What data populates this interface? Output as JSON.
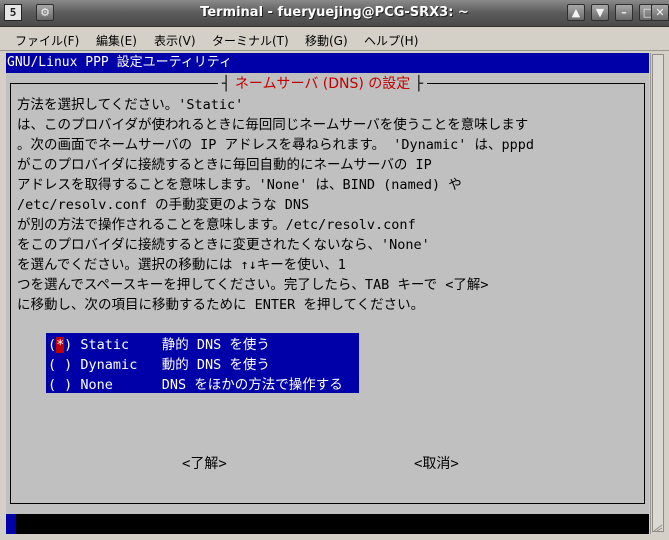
{
  "window": {
    "title": "Terminal - fueryuejing@PCG-SRX3: ~",
    "app_icon": "terminal-icon",
    "controls": {
      "up": "▲",
      "down": "▼",
      "minimize": "–",
      "maximize": "□",
      "close": "✕"
    }
  },
  "menu": [
    {
      "label": "ファイル(F)"
    },
    {
      "label": "編集(E)"
    },
    {
      "label": "表示(V)"
    },
    {
      "label": "ターミナル(T)"
    },
    {
      "label": "移動(G)"
    },
    {
      "label": "ヘルプ(H)"
    }
  ],
  "terminal": {
    "backtitle": "GNU/Linux PPP 設定ユーティリティ",
    "dialog_title": "ネームサーバ (DNS) の設定",
    "dialog_title_left_bar": "┤",
    "dialog_title_right_bar": "├",
    "lines": [
      "方法を選択してください。'Static'",
      "は、このプロバイダが使われるときに毎回同じネームサーバを使うことを意味します",
      "。次の画面でネームサーバの IP アドレスを尋ねられます。 'Dynamic' は、pppd",
      "がこのプロバイダに接続するときに毎回自動的にネームサーバの IP",
      "アドレスを取得することを意味します。'None' は、BIND (named) や",
      "/etc/resolv.conf の手動変更のような DNS",
      "が別の方法で操作されることを意味します。/etc/resolv.conf",
      "をこのプロバイダに接続するときに変更されたくないなら、'None'",
      "を選んでください。選択の移動には ↑↓キーを使い、1",
      "つを選んでスペースキーを押してください。完了したら、TAB キーで <了解>",
      "に移動し、次の項目に移動するために ENTER を押してください。"
    ],
    "options": [
      {
        "mark": "*",
        "name": "Static ",
        "desc": "静的 DNS を使う",
        "selected": true
      },
      {
        "mark": " ",
        "name": "Dynamic",
        "desc": "動的 DNS を使う",
        "selected": false
      },
      {
        "mark": " ",
        "name": "None   ",
        "desc": "DNS をほかの方法で操作する",
        "selected": false
      }
    ],
    "paren_open": "(",
    "paren_close": ")",
    "ok_button": "<了解>",
    "cancel_button": "<取消>"
  },
  "colors": {
    "backtitle_bg": "#0000a8",
    "dialog_bg": "#c0c0c0",
    "title_fg": "#c00000",
    "selection_bg": "#0000a8"
  }
}
